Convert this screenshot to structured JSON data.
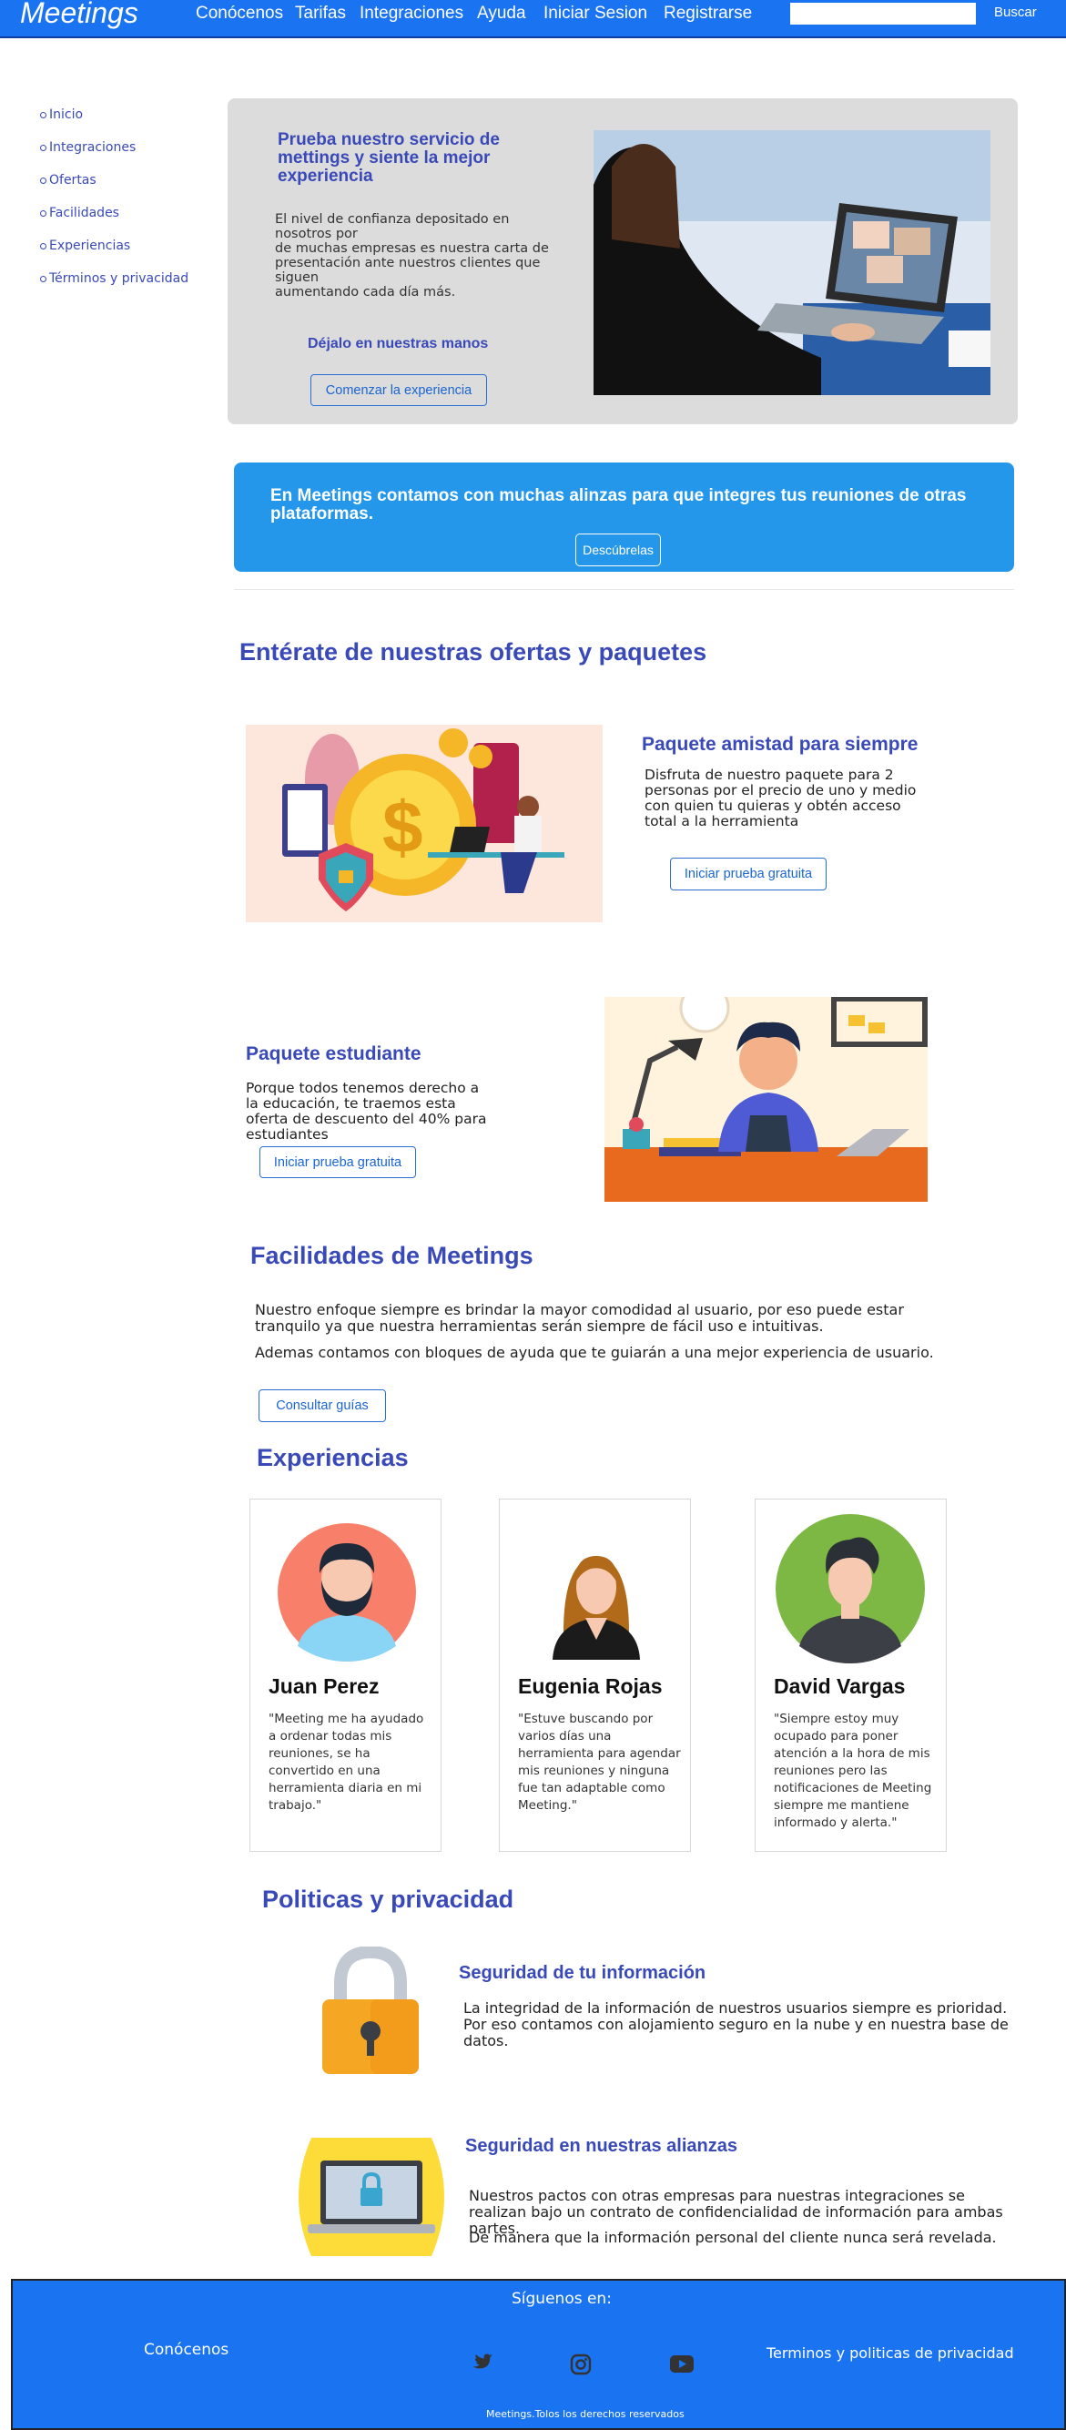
{
  "nav": {
    "brand": "Meetings",
    "links": [
      "Conócenos",
      "Tarifas",
      "Integraciones",
      "Ayuda",
      "Iniciar Sesion",
      "Registrarse"
    ],
    "search_placeholder": "",
    "search_button": "Buscar"
  },
  "sidebar": {
    "items": [
      "Inicio",
      "Integraciones",
      "Ofertas",
      "Facilidades",
      "Experiencias",
      "Términos y privacidad"
    ]
  },
  "hero": {
    "title": "Prueba nuestro servicio de mettings y  siente la mejor experiencia",
    "text": "El nivel de confianza depositado en nosotros por\nde muchas empresas es nuestra carta de presentación ante nuestros clientes que siguen\naumentando cada día más.",
    "subtitle": "Déjalo en nuestras manos",
    "button": "Comenzar la experiencia"
  },
  "banner": {
    "text": "En Meetings contamos con muchas alinzas para que integres tus reuniones de otras plataformas.",
    "button": "Descúbrelas"
  },
  "offers": {
    "heading": "Entérate de nuestras ofertas y paquetes",
    "p1": {
      "title": "Paquete amistad para siempre",
      "text": "Disfruta de nuestro paquete para 2 personas por el precio de uno y medio con quien tu quieras y obtén acceso total a la herramienta",
      "button": "Iniciar prueba gratuita"
    },
    "p2": {
      "title": "Paquete estudiante",
      "text": "Porque todos tenemos derecho a la educación, te traemos esta oferta de descuento del 40% para estudiantes",
      "button": "Iniciar prueba gratuita"
    }
  },
  "facilities": {
    "heading": "Facilidades de Meetings",
    "text1": "Nuestro enfoque siempre es brindar la mayor comodidad al usuario, por eso puede estar tranquilo ya que nuestra herramientas serán siempre de fácil uso e intuitivas.",
    "text2": "Ademas contamos con bloques de ayuda que te guiarán a una mejor experiencia de usuario.",
    "button": "Consultar guías"
  },
  "experiences": {
    "heading": "Experiencias",
    "cards": [
      {
        "name": "Juan Perez",
        "quote": "\"Meeting me ha ayudado a ordenar todas mis reuniones, se ha convertido en una herramienta diaria en mi trabajo.\""
      },
      {
        "name": "Eugenia Rojas",
        "quote": "\"Estuve buscando por varios días una herramienta para agendar mis reuniones y ninguna fue tan adaptable como Meeting.\""
      },
      {
        "name": "David Vargas",
        "quote": "\"Siempre estoy muy ocupado para poner atención a la hora de mis reuniones pero las notificaciones de Meeting siempre me mantiene informado y alerta.\""
      }
    ]
  },
  "privacy": {
    "heading": "Politicas y privacidad",
    "s1": {
      "title": "Seguridad de tu información",
      "text": "La integridad de la información de nuestros usuarios siempre es prioridad. Por eso contamos con alojamiento seguro en la nube y en nuestra base de datos."
    },
    "s2": {
      "title": "Seguridad en nuestras alianzas",
      "text1": "Nuestros pactos con otras empresas para nuestras integraciones se realizan bajo un contrato de confidencialidad de información para ambas partes.",
      "text2": "De manera que la información personal del cliente nunca será revelada."
    }
  },
  "footer": {
    "follow": "Síguenos en:",
    "about": "Conócenos",
    "terms": "Terminos y politicas de privacidad",
    "copyright": "Meetings.Tolos los derechos reservados",
    "icons": [
      "twitter-icon",
      "instagram-icon",
      "youtube-icon"
    ]
  },
  "colors": {
    "primary": "#1a73f0",
    "accent": "#3a49b8",
    "banner": "#2497ea"
  }
}
